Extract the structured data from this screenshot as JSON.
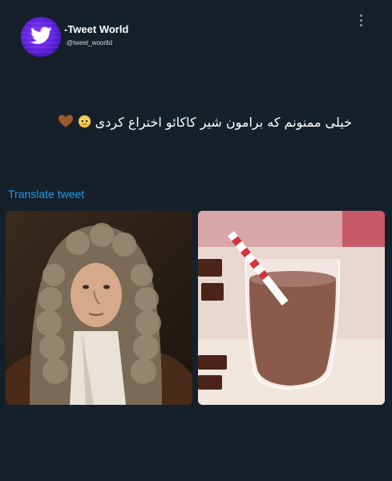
{
  "account": {
    "name": "-Tweet World",
    "handle": "@tweet_woorlld"
  },
  "tweet": {
    "text": "خیلی ممنونم که برامون شیر کاکائو اختراع کردی",
    "emojis": [
      "pleading-face-emoji",
      "brown-heart-emoji"
    ]
  },
  "actions": {
    "translate_label": "Translate tweet",
    "more_icon": "more-vertical-icon"
  },
  "media": [
    {
      "icon": "portrait-photo"
    },
    {
      "icon": "chocolate-milk-photo"
    }
  ],
  "colors": {
    "background": "#15202b",
    "link": "#1d9bf0",
    "avatar": "#6a2cf0"
  }
}
